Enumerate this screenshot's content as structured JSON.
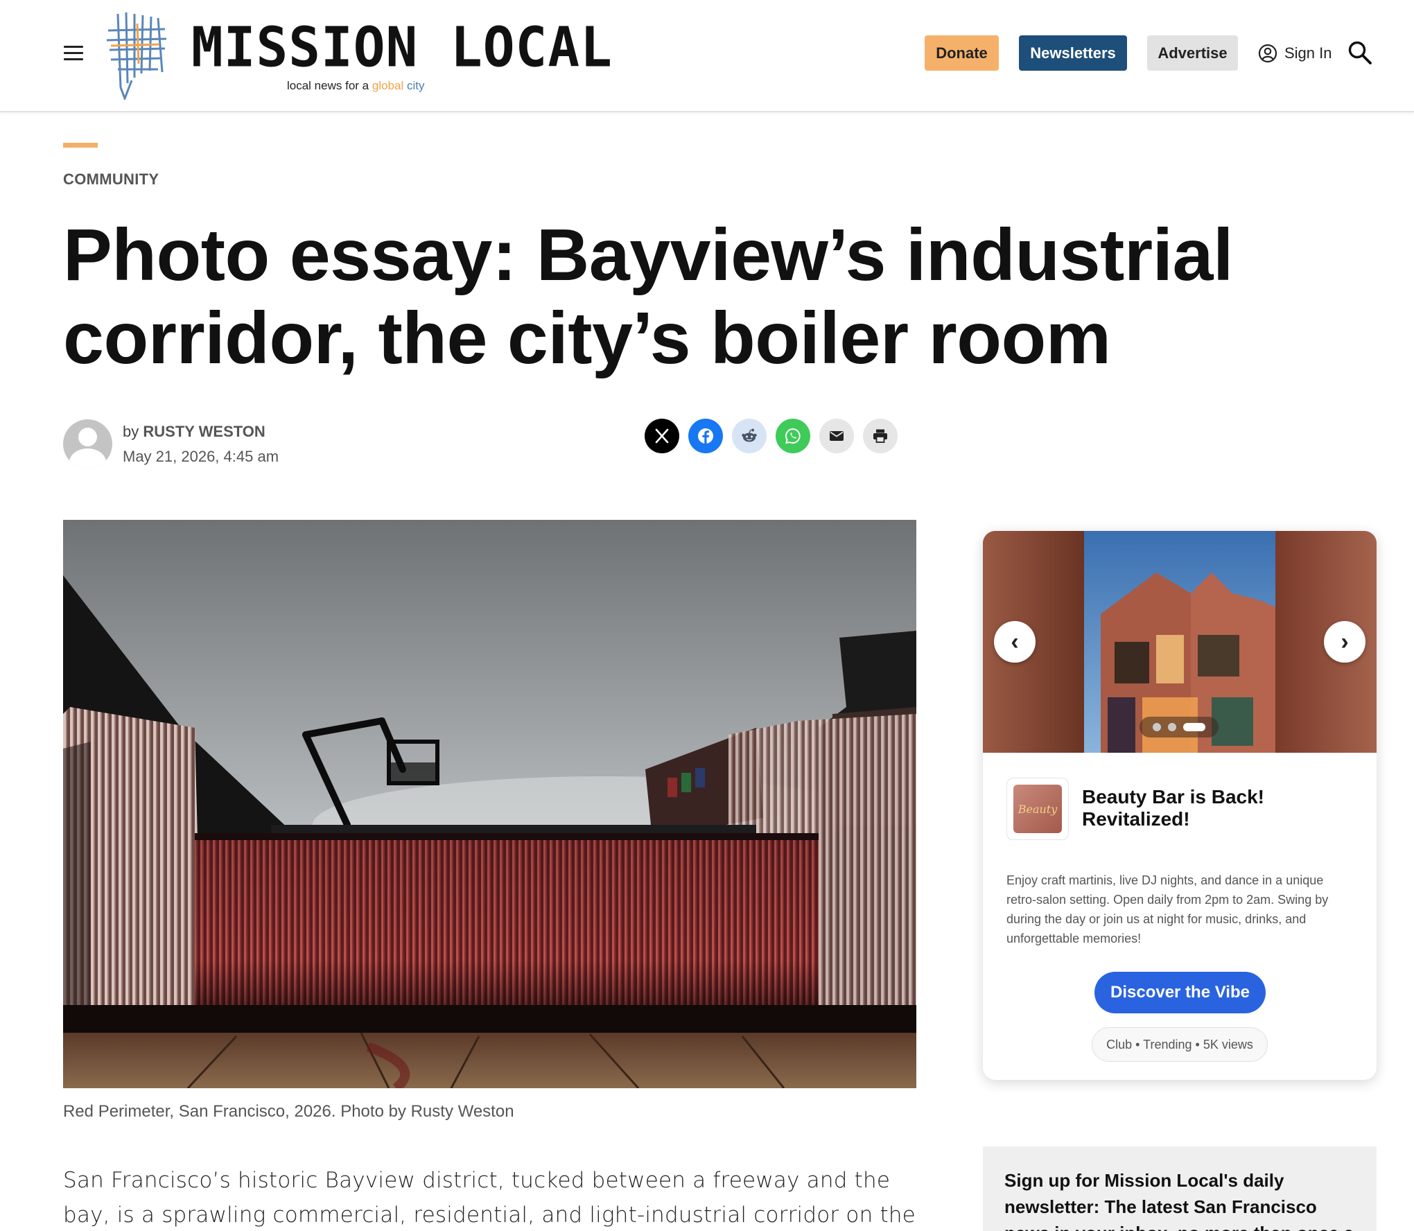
{
  "header": {
    "logo_name": "MISSION LOCAL",
    "tagline_prefix": "local news for a",
    "tagline_global": "global",
    "tagline_city": "city",
    "donate_label": "Donate",
    "newsletters_label": "Newsletters",
    "advertise_label": "Advertise",
    "signin_label": "Sign In",
    "accent_color": "#f5b16a",
    "brand_color": "#1e4e7a"
  },
  "article": {
    "category": "COMMUNITY",
    "title": "Photo essay: Bayview’s industrial corridor, the city’s boiler room",
    "by_prefix": "by",
    "author": "RUSTY WESTON",
    "date": "May 21, 2026, 4:45 am",
    "share_icons": [
      "x-icon",
      "facebook-icon",
      "reddit-icon",
      "whatsapp-icon",
      "email-icon",
      "print-icon"
    ],
    "photo_caption": "Red Perimeter, San Francisco, 2026. Photo by Rusty Weston",
    "body_start": "San Francisco’s historic Bayview district, tucked between a freeway and the bay, is a sprawling commercial, residential, and light-industrial corridor on the city’s southeastern"
  },
  "ad": {
    "prev_label": "‹",
    "next_label": "›",
    "logo_text": "Beauty",
    "title": "Beauty Bar is Back! Revitalized!",
    "description": "Enjoy craft martinis, live DJ nights, and dance in a unique retro-salon setting. Open daily from 2pm to 2am. Swing by during the day or join us at night for music, drinks, and unforgettable memories!",
    "cta_label": "Discover the Vibe",
    "meta": "Club • Trending • 5K views",
    "cta_color": "#2a63e0"
  },
  "newsletter": {
    "title": "Sign up for Mission Local's daily newsletter: The latest San Francisco news in your inbox, no more than once a"
  }
}
